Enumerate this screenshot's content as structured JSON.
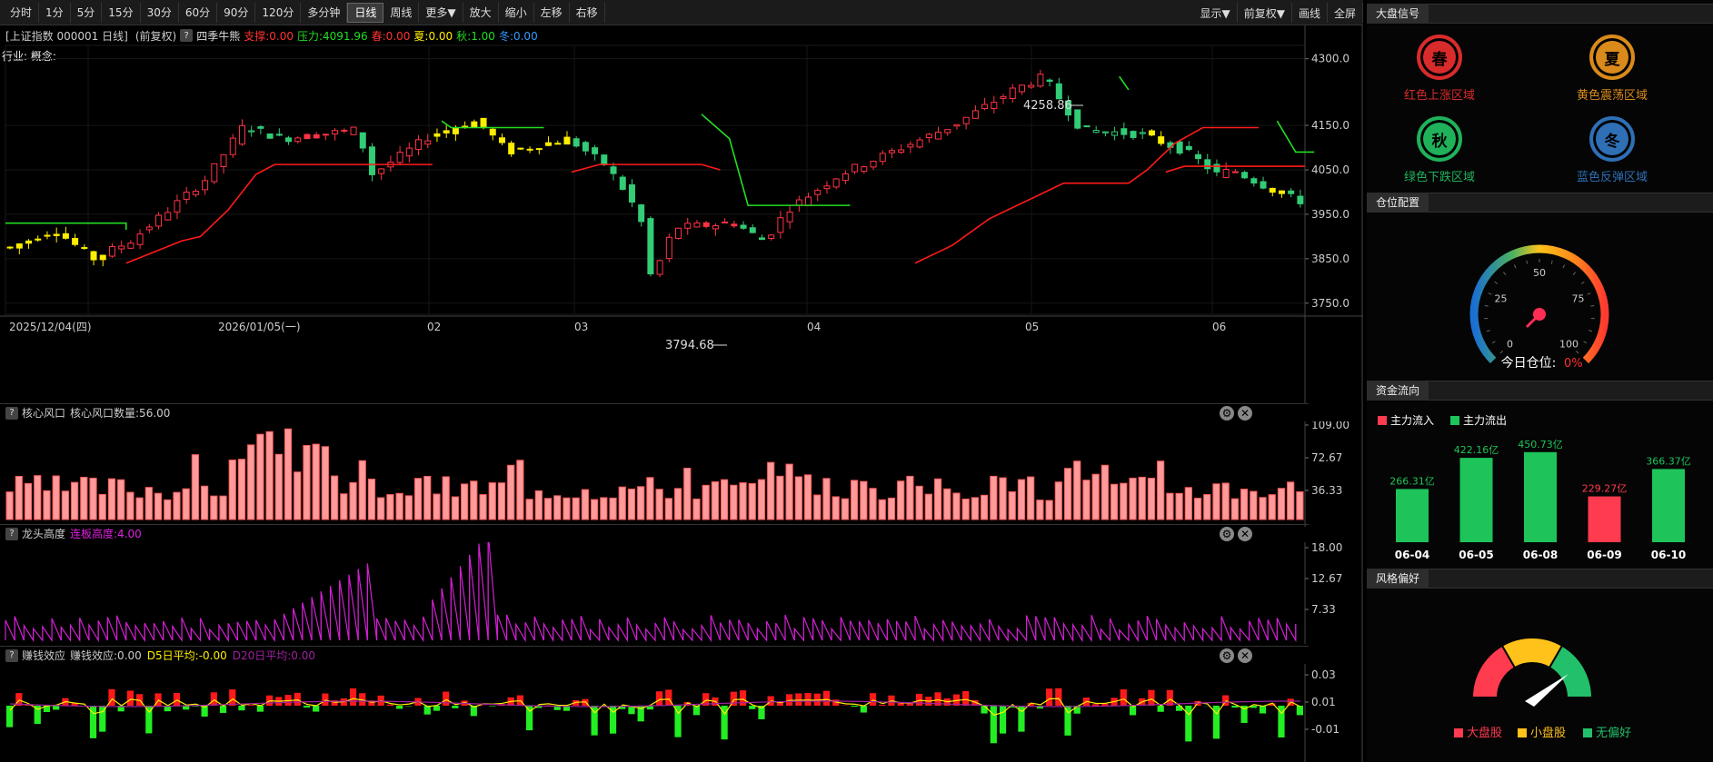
{
  "toolbar": {
    "left_buttons": [
      "分时",
      "1分",
      "5分",
      "15分",
      "30分",
      "60分",
      "90分",
      "120分",
      "多分钟",
      "日线",
      "周线",
      "更多▼",
      "放大",
      "缩小",
      "左移",
      "右移"
    ],
    "active": "日线",
    "right_buttons": [
      "显示▼",
      "前复权▼",
      "画线",
      "全屏"
    ]
  },
  "info": {
    "title": "[上证指数 000001 日线]",
    "adj": "(前复权)",
    "indicator": "四季牛熊",
    "support": "支撑:0.00",
    "pressure": "压力:4091.96",
    "spring": "春:0.00",
    "summer": "夏:0.00",
    "autumn": "秋:1.00",
    "winter": "冬:0.00",
    "industry": "行业: 概念:"
  },
  "main_chart": {
    "y_ticks": [
      "4300.0",
      "4150.0",
      "4050.0",
      "3950.0",
      "3850.0",
      "3750.0"
    ],
    "x_labels": [
      "2025/12/04(四)",
      "2026/01/05(一)",
      "02",
      "03",
      "04",
      "05",
      "06"
    ],
    "high_label": "4258.86",
    "low_label": "3794.68",
    "colors": {
      "up": "#ff3344",
      "down": "#33cc77",
      "yellow": "#ffee00",
      "support_line": "#ff1a1a",
      "pressure_line": "#22dd22"
    }
  },
  "panel1": {
    "name": "核心风口",
    "value_text": "核心风口数量:56.00",
    "y_ticks": [
      "109.00",
      "72.67",
      "36.33"
    ]
  },
  "panel2": {
    "name": "龙头高度",
    "value_text": "连板高度:4.00",
    "y_ticks": [
      "18.00",
      "12.67",
      "7.33"
    ]
  },
  "panel3": {
    "name": "赚钱效应",
    "value_text": "赚钱效应:0.00",
    "d5": "D5日平均:-0.00",
    "d20": "D20日平均:0.00",
    "y_ticks": [
      "0.03",
      "0.01",
      "-0.01"
    ]
  },
  "right": {
    "signal_title": "大盘信号",
    "signals": [
      {
        "icon": "春",
        "label": "红色上涨区域",
        "color": "#d92b2b"
      },
      {
        "icon": "夏",
        "label": "黄色震荡区域",
        "color": "#d98a1a"
      },
      {
        "icon": "秋",
        "label": "绿色下跌区域",
        "color": "#1fb25a"
      },
      {
        "icon": "冬",
        "label": "蓝色反弹区域",
        "color": "#2e6fb5"
      }
    ],
    "position_title": "仓位配置",
    "gauge_ticks": [
      "0",
      "25",
      "50",
      "75",
      "100"
    ],
    "position_label": "今日仓位:",
    "position_value": "0%",
    "flow_title": "资金流向",
    "flow_legend": [
      "主力流入",
      "主力流出"
    ],
    "flow_data": [
      {
        "date": "06-04",
        "value": 266.31,
        "label": "266.31亿",
        "dir": "out"
      },
      {
        "date": "06-05",
        "value": 422.16,
        "label": "422.16亿",
        "dir": "out"
      },
      {
        "date": "06-08",
        "value": 450.73,
        "label": "450.73亿",
        "dir": "out"
      },
      {
        "date": "06-09",
        "value": 229.27,
        "label": "229.27亿",
        "dir": "in"
      },
      {
        "date": "06-10",
        "value": 366.37,
        "label": "366.37亿",
        "dir": "out"
      }
    ],
    "style_title": "风格偏好",
    "style_legend": [
      "大盘股",
      "小盘股",
      "无偏好"
    ]
  }
}
